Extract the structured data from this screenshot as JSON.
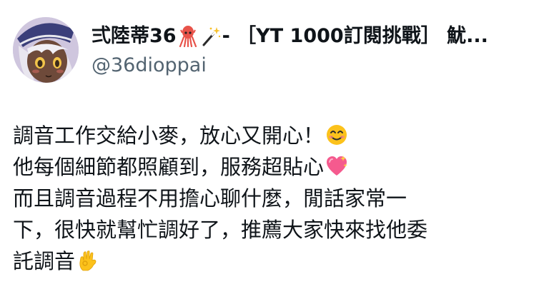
{
  "author": {
    "display_name": "弍陸蒂36",
    "name_emojis": [
      "squid-icon",
      "magic-wand-icon"
    ],
    "name_suffix": "- ［YT 1000訂閱挑戰］ 魷...",
    "handle": "@36dioppai"
  },
  "tweet": {
    "lines": [
      {
        "text": "調音工作交給小麥，放心又開心！",
        "emoji": "smiling-face-icon"
      },
      {
        "text": "他每個細節都照顧到，服務超貼心",
        "emoji": "sparkling-heart-icon"
      },
      {
        "text": "而且調音過程不用擔心聊什麼，閒話家常一",
        "emoji": ""
      },
      {
        "text": "下，很快就幫忙調好了，推薦大家快來找他委",
        "emoji": ""
      },
      {
        "text": "託調音",
        "emoji": "ok-hand-icon"
      }
    ]
  },
  "colors": {
    "text": "#0f1419",
    "secondary_text": "#536471",
    "background": "#ffffff"
  }
}
